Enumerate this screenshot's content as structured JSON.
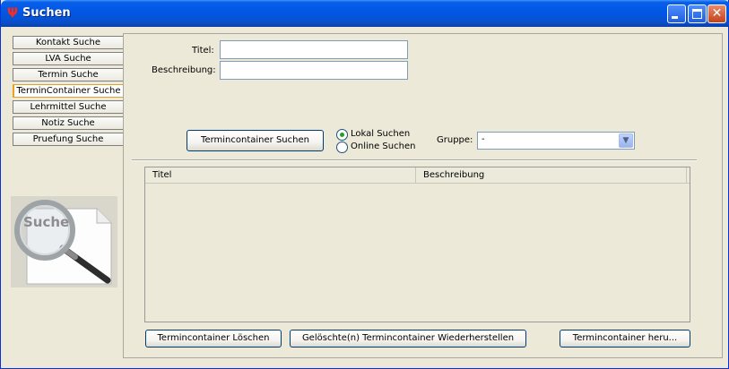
{
  "window": {
    "title": "Suchen",
    "app_icon": "psi-icon"
  },
  "nav": {
    "items": [
      {
        "label": "Kontakt Suche"
      },
      {
        "label": "LVA Suche"
      },
      {
        "label": "Termin Suche"
      },
      {
        "label": "TerminContainer Suche",
        "active": true
      },
      {
        "label": "Lehrmittel Suche"
      },
      {
        "label": "Notiz Suche"
      },
      {
        "label": "Pruefung Suche"
      }
    ]
  },
  "illustration": {
    "text": "Suche"
  },
  "form": {
    "titel_label": "Titel:",
    "titel_value": "",
    "beschreibung_label": "Beschreibung:",
    "beschreibung_value": "",
    "search_button": "Termincontainer Suchen",
    "radio_lokal": "Lokal Suchen",
    "radio_online": "Online Suchen",
    "selected_scope": "Lokal Suchen",
    "gruppe_label": "Gruppe:",
    "gruppe_value": "-"
  },
  "table": {
    "columns": [
      "Titel",
      "Beschreibung"
    ],
    "rows": []
  },
  "actions": {
    "delete": "Termincontainer Löschen",
    "restore": "Gelöschte(n) Termincontainer Wiederherstellen",
    "download": "Termincontainer heru..."
  }
}
